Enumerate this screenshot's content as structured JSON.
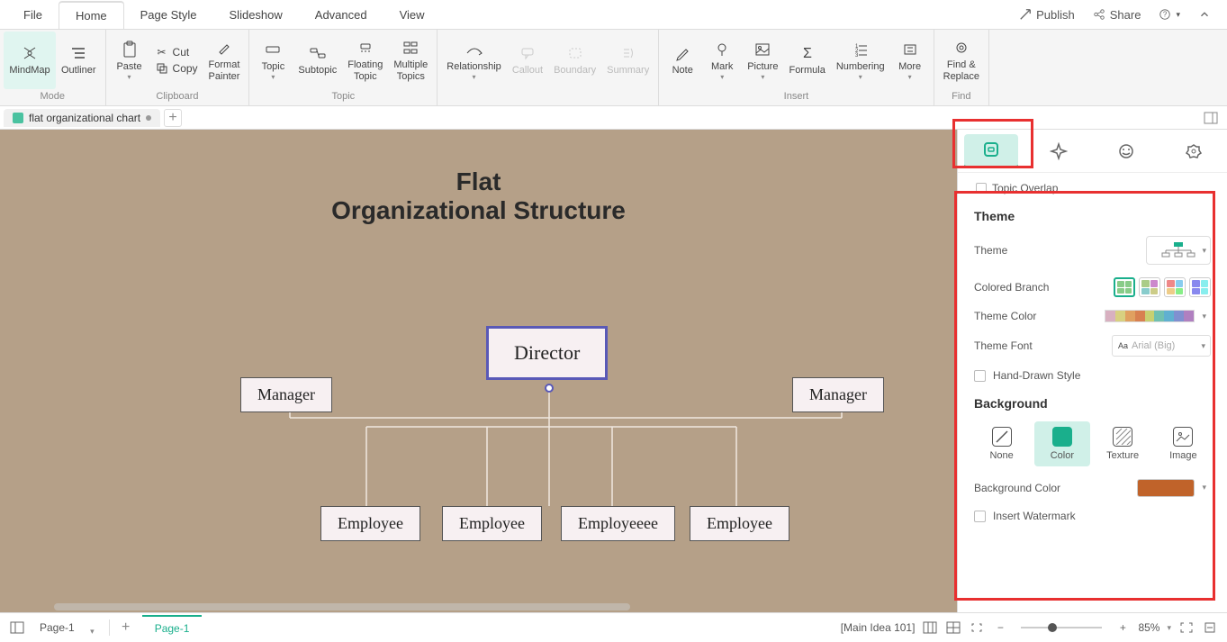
{
  "menu": {
    "tabs": [
      "File",
      "Home",
      "Page Style",
      "Slideshow",
      "Advanced",
      "View"
    ],
    "active": 1,
    "right": {
      "publish": "Publish",
      "share": "Share"
    }
  },
  "ribbon": {
    "mode": {
      "label": "Mode",
      "mindmap": "MindMap",
      "outliner": "Outliner"
    },
    "clipboard": {
      "label": "Clipboard",
      "paste": "Paste",
      "cut": "Cut",
      "copy": "Copy",
      "format_painter": "Format\nPainter"
    },
    "topic": {
      "label": "Topic",
      "topic": "Topic",
      "subtopic": "Subtopic",
      "floating": "Floating\nTopic",
      "multiple": "Multiple\nTopics"
    },
    "rel": {
      "relationship": "Relationship",
      "callout": "Callout",
      "boundary": "Boundary",
      "summary": "Summary"
    },
    "insert": {
      "label": "Insert",
      "note": "Note",
      "mark": "Mark",
      "picture": "Picture",
      "formula": "Formula",
      "numbering": "Numbering",
      "more": "More"
    },
    "find": {
      "label": "Find",
      "find_replace": "Find &\nReplace"
    }
  },
  "doc_tab": {
    "name": "flat organizational chart"
  },
  "canvas": {
    "title_line1": "Flat",
    "title_line2": "Organizational Structure",
    "director": "Director",
    "manager": "Manager",
    "employee": "Employee",
    "employeee": "Employeeee"
  },
  "panel": {
    "topic_overlap": "Topic Overlap",
    "theme_title": "Theme",
    "theme_label": "Theme",
    "colored_branch": "Colored Branch",
    "theme_color": "Theme Color",
    "theme_font": "Theme Font",
    "font_value": "Arial (Big)",
    "hand_drawn": "Hand-Drawn Style",
    "background_title": "Background",
    "bg_none": "None",
    "bg_color": "Color",
    "bg_texture": "Texture",
    "bg_image": "Image",
    "bg_color_label": "Background Color",
    "insert_watermark": "Insert Watermark"
  },
  "status": {
    "page_select": "Page-1",
    "page_tab": "Page-1",
    "main_idea": "[Main Idea 101]",
    "zoom": "85%"
  }
}
